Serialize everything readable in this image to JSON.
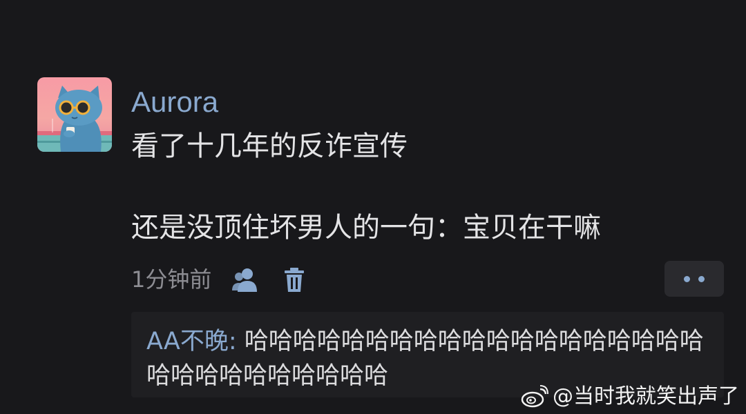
{
  "comment": {
    "username": "Aurora",
    "lines": [
      "看了十几年的反诈宣传",
      "还是没顶住坏男人的一句：宝贝在干嘛"
    ],
    "time": "1分钟前"
  },
  "icons": {
    "user": "user-icon",
    "delete": "trash-icon",
    "more": "more-icon"
  },
  "reply": {
    "author": "AA不晚",
    "separator": ": ",
    "text": "哈哈哈哈哈哈哈哈哈哈哈哈哈哈哈哈哈哈哈哈哈哈哈哈哈哈哈哈哈"
  },
  "watermark": {
    "text": "@当时我就笑出声了"
  },
  "colors": {
    "background": "#18181b",
    "accent": "#8aa9cf",
    "text": "#e4e4e6",
    "muted": "#8d8d93",
    "reply_bg": "#1f1f22"
  }
}
